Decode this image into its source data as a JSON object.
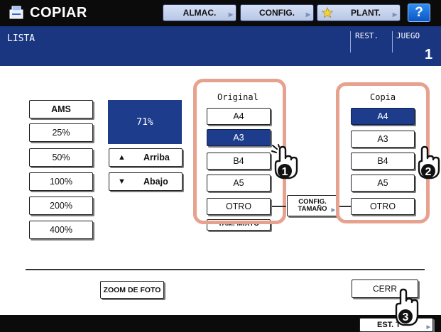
{
  "header": {
    "title": "COPIAR",
    "buttons": [
      "ALMAC.",
      "CONFIG.",
      "PLANT."
    ],
    "help_label": "?"
  },
  "status": {
    "message": "LISTA",
    "rest_label": "REST.",
    "juego_label": "JUEGO",
    "juego_value": "1"
  },
  "zoom_presets": [
    "AMS",
    "25%",
    "50%",
    "100%",
    "200%",
    "400%"
  ],
  "zoom": {
    "value": "71%",
    "up_label": "Arriba",
    "down_label": "Abajo"
  },
  "original": {
    "label": "Original",
    "sizes": [
      "A4",
      "A3",
      "B4",
      "A5",
      "OTRO"
    ],
    "selected": "A3",
    "mixed_label": "TAM. MIXTO"
  },
  "config_tamano": {
    "line1": "CONFIG.",
    "line2": "TAMAÑO"
  },
  "copia": {
    "label": "Copia",
    "sizes": [
      "A4",
      "A3",
      "B4",
      "A5",
      "OTRO"
    ],
    "selected": "A4"
  },
  "actions": {
    "photo_zoom": "ZOOM DE FOTO",
    "close": "CERR",
    "est": "EST. T"
  },
  "callouts": [
    "1",
    "2",
    "3"
  ],
  "colors": {
    "header_bg": "#0b0b0b",
    "status_bg": "#1a3680",
    "selected_bg": "#1d3d8c",
    "highlight_outline": "#e7a28f"
  },
  "icons": [
    "copier-icon",
    "star-icon",
    "up-triangle-icon",
    "down-triangle-icon",
    "tap-hand-icon"
  ]
}
